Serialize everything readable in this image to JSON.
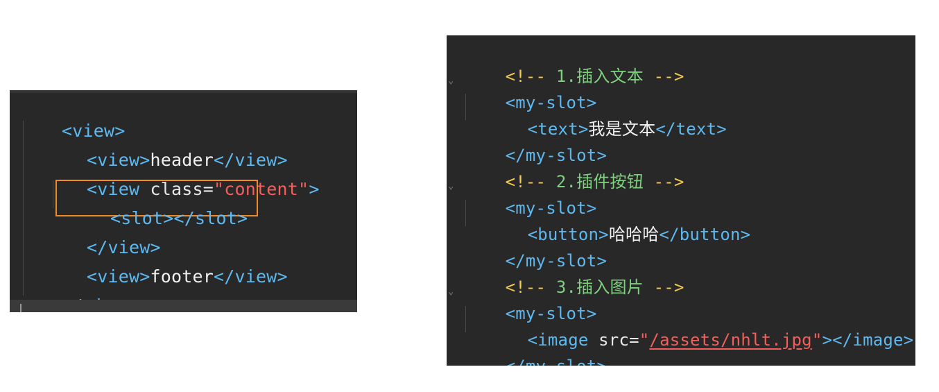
{
  "left_code": {
    "lines": [
      {
        "parts": [
          "<view>"
        ]
      },
      {
        "parts": [
          "<view>",
          "header",
          "</view>"
        ]
      },
      {
        "parts": [
          "<view ",
          "class=",
          "\"content\"",
          ">"
        ]
      },
      {
        "parts": [
          "<slot>",
          "</slot>"
        ]
      },
      {
        "parts": [
          "</view>"
        ]
      },
      {
        "parts": [
          "<view>",
          "footer",
          "</view>"
        ]
      },
      {
        "parts": [
          "</view>"
        ]
      }
    ],
    "highlight_color": "#f28c28"
  },
  "right_code": {
    "comment1": {
      "open": "<!-- ",
      "text": "1.插入文本",
      "close": " -->"
    },
    "block1_open": "<my-slot>",
    "block1_inner": {
      "open": "<text>",
      "text": "我是文本",
      "close": "</text>"
    },
    "block1_close": "</my-slot>",
    "comment2": {
      "open": "<!-- ",
      "text": "2.插件按钮",
      "close": " -->"
    },
    "block2_open": "<my-slot>",
    "block2_inner": {
      "open": "<button>",
      "text": "哈哈哈",
      "close": "</button>"
    },
    "block2_close": "</my-slot>",
    "comment3": {
      "open": "<!-- ",
      "text": "3.插入图片",
      "close": " -->"
    },
    "block3_open": "<my-slot>",
    "block3_inner": {
      "open": "<image ",
      "attr": "src=",
      "quote_open": "\"",
      "value": "/assets/nhlt.jpg",
      "quote_close": "\"",
      "close": "></image>"
    },
    "block3_close": "</my-slot>",
    "fold_icon": "chevron-down-icon"
  },
  "colors": {
    "editor_bg": "#282828",
    "tag": "#5eb9f0",
    "string": "#f25f5c",
    "comment_marker": "#f7c948",
    "comment_text": "#7fd17f"
  }
}
